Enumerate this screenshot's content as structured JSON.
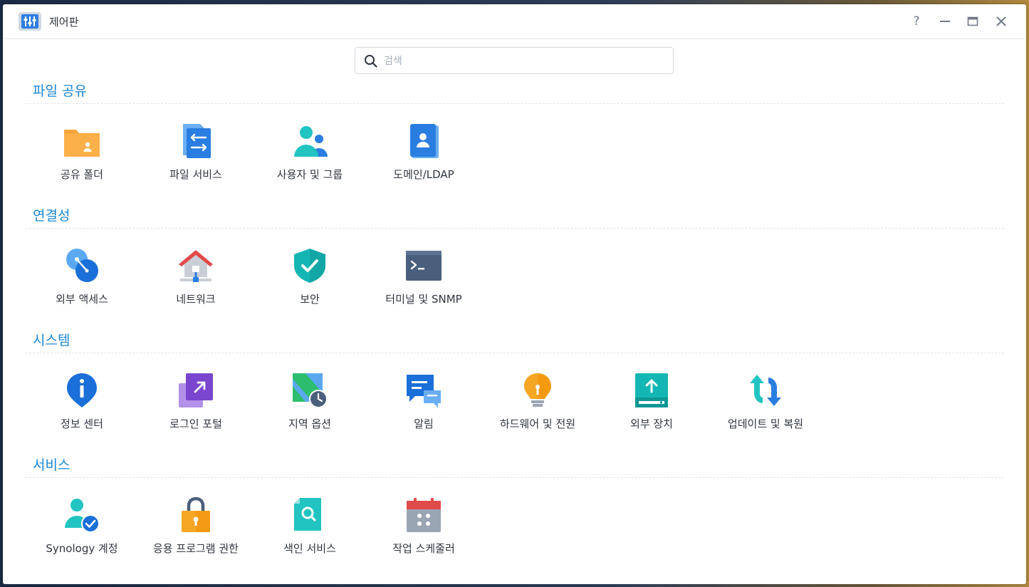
{
  "window": {
    "title": "제어판",
    "help_label": "?",
    "app_icon": "control-panel-icon",
    "controls": [
      "help-icon",
      "minimize-icon",
      "maximize-icon",
      "close-icon"
    ]
  },
  "search": {
    "placeholder": "검색",
    "value": "",
    "icon": "search-icon"
  },
  "sections": [
    {
      "title": "파일 공유",
      "items": [
        {
          "label": "공유 폴더",
          "icon": "shared-folder-icon"
        },
        {
          "label": "파일 서비스",
          "icon": "file-services-icon"
        },
        {
          "label": "사용자 및 그룹",
          "icon": "user-group-icon"
        },
        {
          "label": "도메인/LDAP",
          "icon": "domain-ldap-icon"
        }
      ]
    },
    {
      "title": "연결성",
      "items": [
        {
          "label": "외부 액세스",
          "icon": "external-access-icon"
        },
        {
          "label": "네트워크",
          "icon": "network-icon"
        },
        {
          "label": "보안",
          "icon": "security-shield-icon"
        },
        {
          "label": "터미널 및 SNMP",
          "icon": "terminal-icon"
        }
      ]
    },
    {
      "title": "시스템",
      "items": [
        {
          "label": "정보 센터",
          "icon": "info-center-icon"
        },
        {
          "label": "로그인 포털",
          "icon": "login-portal-icon"
        },
        {
          "label": "지역 옵션",
          "icon": "regional-options-icon"
        },
        {
          "label": "알림",
          "icon": "notification-icon"
        },
        {
          "label": "하드웨어 및 전원",
          "icon": "hardware-power-icon"
        },
        {
          "label": "외부 장치",
          "icon": "external-devices-icon"
        },
        {
          "label": "업데이트 및 복원",
          "icon": "update-restore-icon"
        }
      ]
    },
    {
      "title": "서비스",
      "items": [
        {
          "label": "Synology 계정",
          "icon": "synology-account-icon"
        },
        {
          "label": "응용 프로그램 권한",
          "icon": "app-privileges-icon"
        },
        {
          "label": "색인 서비스",
          "icon": "indexing-service-icon"
        },
        {
          "label": "작업 스케줄러",
          "icon": "task-scheduler-icon"
        }
      ]
    }
  ]
}
